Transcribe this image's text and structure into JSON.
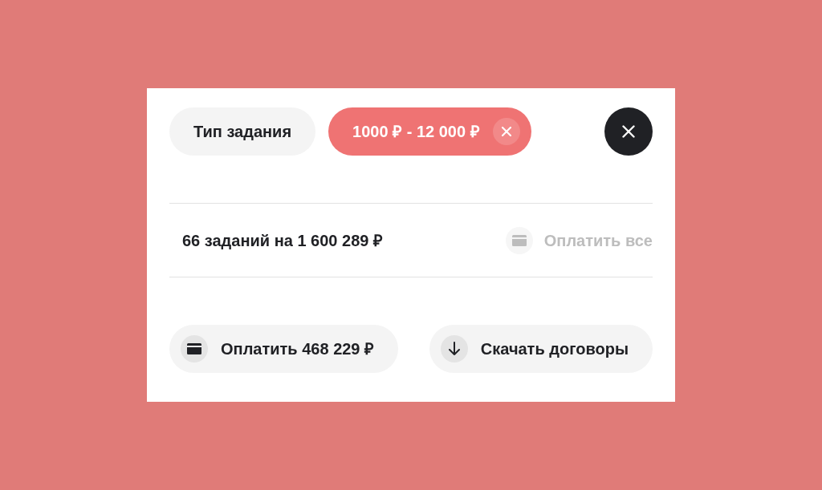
{
  "filters": [
    {
      "label": "Тип задания",
      "selected": false
    },
    {
      "label": "1000 ₽ - 12 000 ₽",
      "selected": true
    }
  ],
  "summary": {
    "text": "66 заданий на 1 600 289 ₽",
    "pay_all": {
      "label": "Оплатить все",
      "disabled": true
    }
  },
  "actions": [
    {
      "kind": "pay",
      "label": "Оплатить 468 229 ₽"
    },
    {
      "kind": "download",
      "label": "Скачать договоры"
    }
  ]
}
